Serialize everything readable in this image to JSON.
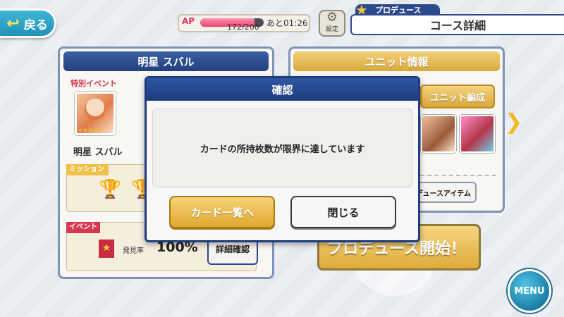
{
  "header": {
    "back_label": "戻る",
    "ap_label": "AP",
    "ap_current": 172,
    "ap_max": 200,
    "ap_text": "172/200",
    "ap_timer": "あと01:26",
    "settings_label": "設定",
    "produce_tab": "プロデュース",
    "course_title": "コース詳細"
  },
  "left_panel": {
    "title": "明星 スバル",
    "event_tag": "特別イベント",
    "character_name": "明星 スバル",
    "mission_label": "ミッション",
    "event_label": "イベント",
    "find_rate_label": "発見率",
    "find_rate_value": "100%",
    "detail_button": "詳細確認"
  },
  "right_panel": {
    "title": "ユニット情報",
    "unit_edit_button": "ユニット編成",
    "items_button": "デュースアイテム"
  },
  "start_button": "プロデュース開始！",
  "menu_button": "MENU",
  "dialog": {
    "title": "確認",
    "message": "カードの所持枚数が限界に達しています",
    "primary_button": "カード一覧へ",
    "secondary_button": "閉じる"
  }
}
